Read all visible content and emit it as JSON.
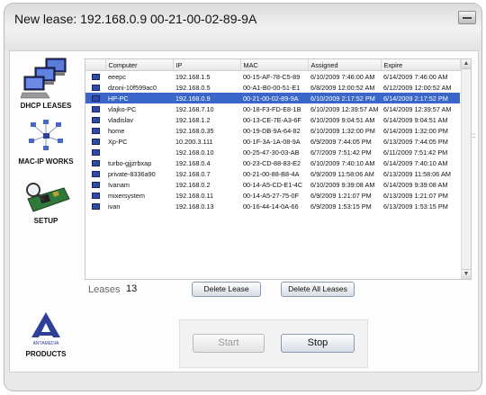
{
  "window": {
    "title": "New lease:  192.168.0.9  00-21-00-02-89-9A"
  },
  "sidebar": {
    "items": [
      {
        "label": "DHCP LEASES",
        "icon": "computers-icon"
      },
      {
        "label": "MAC-IP WORKS",
        "icon": "network-icon"
      },
      {
        "label": "SETUP",
        "icon": "network-card-icon"
      },
      {
        "label": "PRODUCTS",
        "icon": "antamedia-logo-icon",
        "logo_text": "ANTAMEDIA"
      }
    ]
  },
  "table": {
    "columns": [
      "Computer",
      "IP",
      "MAC",
      "Assigned",
      "Expire"
    ],
    "selected_index": 2,
    "rows": [
      [
        "eeepc",
        "192.168.1.5",
        "00-15-AF-78-C5-89",
        "6/10/2009 7:46:00 AM",
        "6/14/2009 7:46:00 AM"
      ],
      [
        "dzoni-10f599ac0",
        "192.168.0.5",
        "00-A1-B0-00-51-E1",
        "6/8/2009 12:00:52 AM",
        "6/12/2009 12:00:52 AM"
      ],
      [
        "HP-PC",
        "192.168.0.9",
        "00-21-00-02-89-9A",
        "6/10/2009 2:17:52 PM",
        "6/14/2009 2:17:52 PM"
      ],
      [
        "vlajko-PC",
        "192.168.7.10",
        "00-18-F3-FD-E8-1B",
        "6/10/2009 12:39:57 AM",
        "6/14/2009 12:39:57 AM"
      ],
      [
        "vladislav",
        "192.168.1.2",
        "00-13-CE-7E-A3-6F",
        "6/10/2009 9:04:51 AM",
        "6/14/2009 9:04:51 AM"
      ],
      [
        "home",
        "192.168.0.35",
        "00-19-DB-9A-64-82",
        "6/10/2009 1:32:00 PM",
        "6/14/2009 1:32:00 PM"
      ],
      [
        "Xp-PC",
        "10.200.3.111",
        "00-1F-3A-1A-08-9A",
        "6/9/2009 7:44:05 PM",
        "6/13/2009 7:44:05 PM"
      ],
      [
        "",
        "192.168.0.10",
        "00-25-47-30-03-AB",
        "6/7/2009 7:51:42 PM",
        "6/11/2009 7:51:42 PM"
      ],
      [
        "turbo-gjjzrbxap",
        "192.168.0.4",
        "00-23-CD-88-83-E2",
        "6/10/2009 7:40:10 AM",
        "6/14/2009 7:40:10 AM"
      ],
      [
        "private-8336a90",
        "192.168.0.7",
        "00-21-00-88-B8-4A",
        "6/9/2009 11:58:06 AM",
        "6/13/2009 11:58:06 AM"
      ],
      [
        "Ivanam",
        "192.168.0.2",
        "00-14-A5-CD-E1-4C",
        "6/10/2009 9:39:08 AM",
        "6/14/2009 9:39:08 AM"
      ],
      [
        "mixersystem",
        "192.168.0.11",
        "00-14-A5-27-75-0F",
        "6/9/2009 1:21:07 PM",
        "6/13/2009 1:21:07 PM"
      ],
      [
        "ivan",
        "192.168.0.13",
        "00-16-44-14-0A-66",
        "6/9/2009 1:53:15 PM",
        "6/13/2009 1:53:15 PM"
      ]
    ]
  },
  "leases": {
    "label": "Leases",
    "count": "13"
  },
  "buttons": {
    "delete_lease": "Delete Lease",
    "delete_all_leases": "Delete All Leases",
    "start": "Start",
    "stop": "Stop"
  },
  "colors": {
    "selection": "#3a66c9",
    "accent": "#2f4aa8"
  }
}
